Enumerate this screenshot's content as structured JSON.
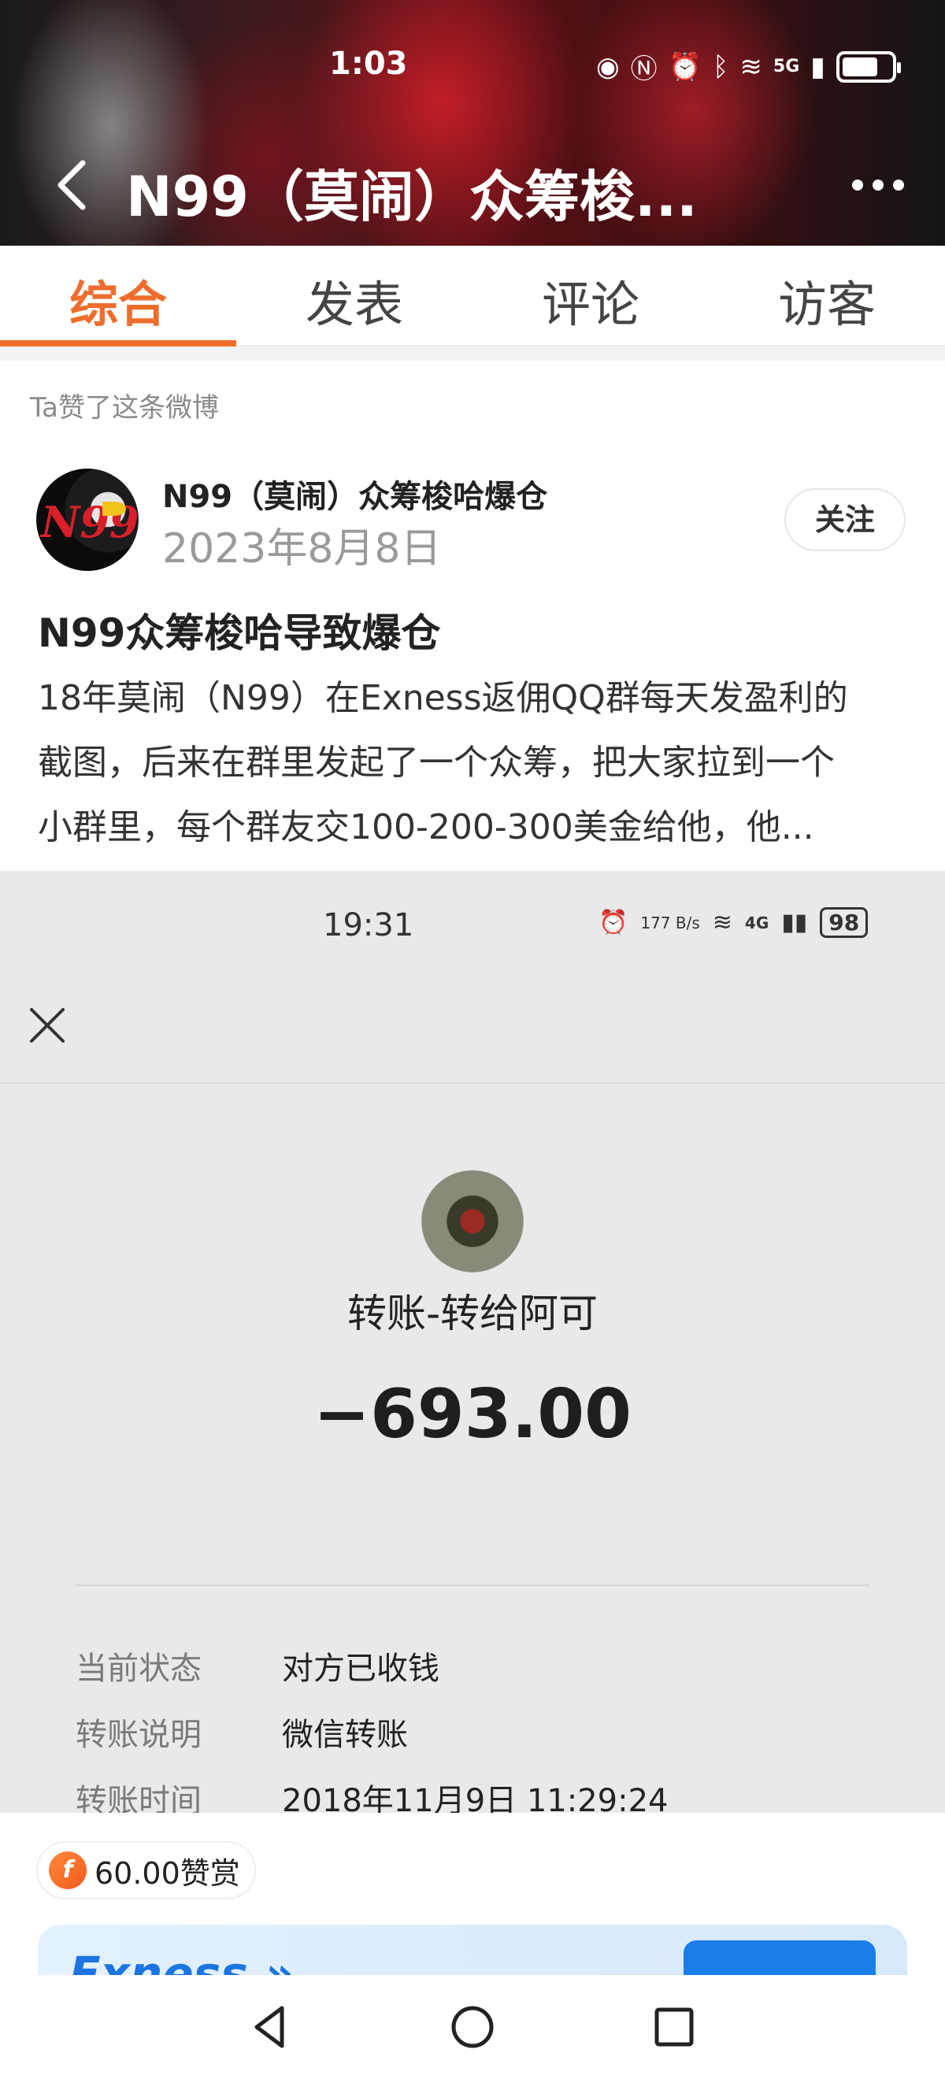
{
  "status_bar": {
    "time": "1:03",
    "network": "5G"
  },
  "header": {
    "title": "N99（莫闹）众筹梭..."
  },
  "tabs": [
    {
      "label": "综合"
    },
    {
      "label": "发表"
    },
    {
      "label": "评论"
    },
    {
      "label": "访客"
    }
  ],
  "post": {
    "liked_note": "Ta赞了这条微博",
    "author": "N99（莫闹）众筹梭哈爆仓",
    "avatar_text": "N99",
    "date": "2023年8月8日",
    "follow_label": "关注",
    "title": "N99众筹梭哈导致爆仓",
    "body_lines": [
      "18年莫闹（N99）在Exness返佣QQ群每天发盈利的",
      "截图，后来在群里发起了一个众筹，把大家拉到一个",
      "小群里，每个群友交100-200-300美金给他，他..."
    ]
  },
  "screenshot": {
    "time": "19:31",
    "speed": "177 B/s",
    "network": "4G",
    "battery": "98",
    "transfer_title": "转账-转给阿可",
    "amount": "−693.00",
    "details": [
      {
        "key": "当前状态",
        "value": "对方已收钱"
      },
      {
        "key": "转账说明",
        "value": "微信转账"
      },
      {
        "key": "转账时间",
        "value": "2018年11月9日 11:29:24"
      }
    ]
  },
  "reward": {
    "coin_symbol": "f",
    "label": "60.00赞赏"
  },
  "ad": {
    "brand": "Exness »"
  },
  "colors": {
    "accent": "#ee6d2d",
    "ad_blue": "#1a7de8"
  }
}
